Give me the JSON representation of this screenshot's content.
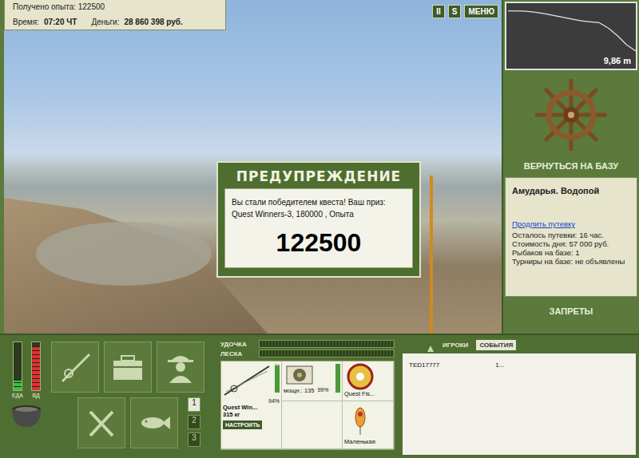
{
  "info": {
    "experience": "Получено опыта: 122500",
    "time_label": "Время:",
    "time": "07:20 ЧТ",
    "money_label": "Деньги:",
    "money": "28 860 398 руб."
  },
  "top_buttons": [
    {
      "label": "II"
    },
    {
      "label": "S"
    },
    {
      "label": "МЕНЮ"
    }
  ],
  "dialog": {
    "title": "ПРЕДУПРЕЖДЕНИЕ",
    "message": "Вы стали победителем квеста! Ваш приз: Quest Winners-3, 180000 , Опыта",
    "amount": "122500"
  },
  "depth_chart": {
    "values": [
      1.0,
      1.0,
      1.1,
      1.3,
      1.6,
      2.0,
      2.4,
      2.8,
      3.2,
      3.4,
      3.6,
      4.8,
      6.5,
      8.5,
      9.86
    ],
    "reading": "9,86 m"
  },
  "return_button": "ВЕРНУТЬСЯ НА БАЗУ",
  "location": {
    "title": "Амударья. Водопой",
    "link": "Продлить путевку",
    "lines": [
      "Осталось путевки: 16 час.",
      "Стоимость дня: 57 000 руб.",
      "Рыбаков на базе: 1",
      "Турниры на базе: не объявлены"
    ]
  },
  "bans_button": "ЗАПРЕТЫ",
  "meters": [
    {
      "label": "ЕДА",
      "level": 0.2,
      "color": "#3fbf3f"
    },
    {
      "label": "ВД",
      "level": 0.92,
      "color": "#e03030"
    }
  ],
  "slots": [
    {
      "label": "1",
      "selected": true
    },
    {
      "label": "2",
      "selected": false
    },
    {
      "label": "3",
      "selected": false
    }
  ],
  "tension": [
    {
      "label": "УДОЧКА",
      "level": 0
    },
    {
      "label": "ЛЕСКА",
      "level": 0
    }
  ],
  "tackle": {
    "rod": {
      "name": "Quest Win...",
      "capacity": "315 кг",
      "level": 0.94,
      "reading": "94%"
    },
    "setup_button": "НАСТРОИТЬ",
    "reel": {
      "power": "мощн.: 135",
      "level": 0.99,
      "reading": "99%"
    },
    "line": {
      "name": "Quest Fis..."
    },
    "lure": {
      "name": "Маленькая"
    }
  },
  "tabs": [
    {
      "label": "ИГРОКИ",
      "selected": false
    },
    {
      "label": "СОБЫТИЯ",
      "selected": true
    }
  ],
  "events": [
    {
      "player": "TED17777",
      "value": "1..."
    }
  ]
}
